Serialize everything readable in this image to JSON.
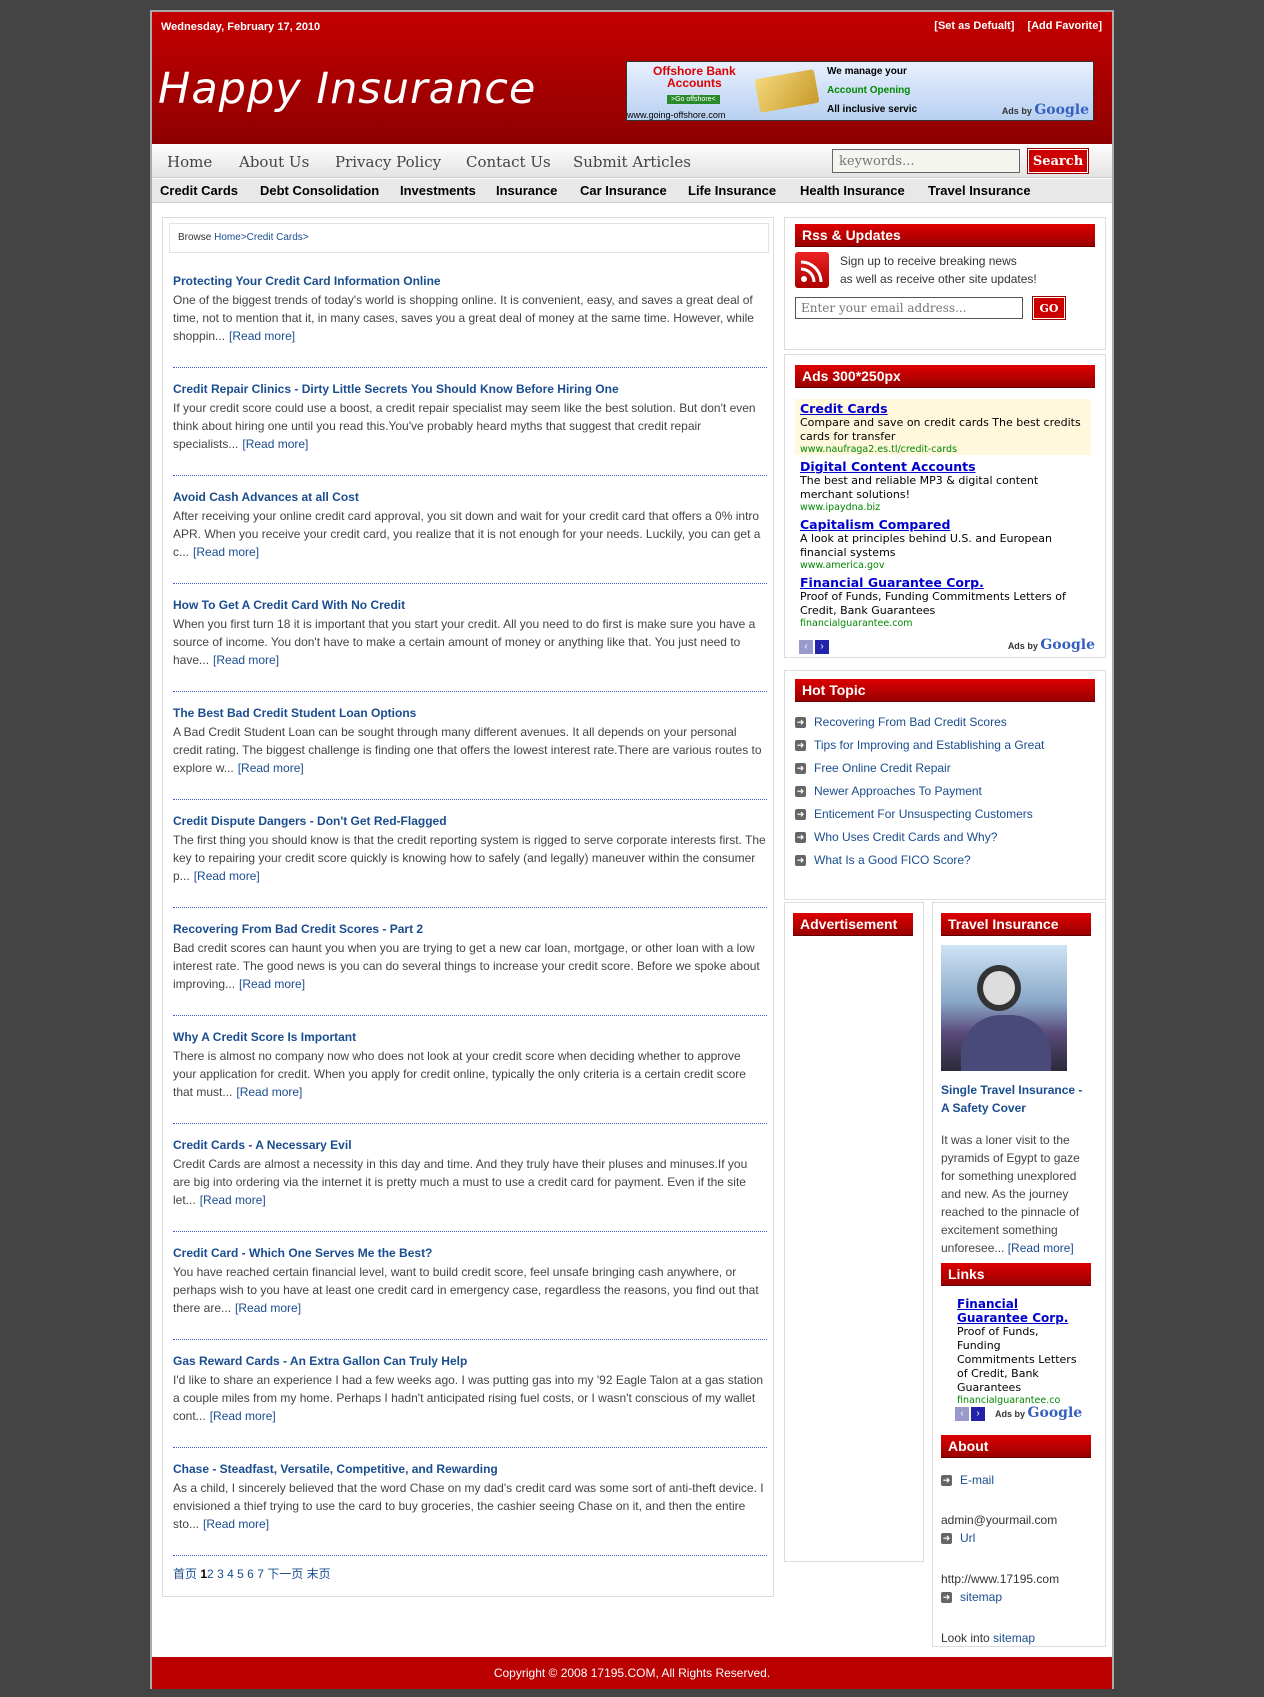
{
  "header": {
    "date": "Wednesday, February 17, 2010",
    "set_default": "[Set as Defualt]",
    "add_favorite": "[Add Favorite]",
    "site_title": "Happy Insurance",
    "banner": {
      "line1": "Offshore Bank",
      "line2": "Accounts",
      "cta": ">Go offshore<",
      "text1": "We manage your",
      "text2": "Account Opening",
      "text3": "All inclusive servic",
      "url": "www.going-offshore.com",
      "ads_by": "Ads by",
      "google": "Google"
    }
  },
  "nav": {
    "items": [
      "Home",
      "About Us",
      "Privacy Policy",
      "Contact Us",
      "Submit Articles"
    ],
    "search_placeholder": "keywords...",
    "search_button": "Search"
  },
  "categories": [
    "Credit Cards",
    "Debt Consolidation",
    "Investments",
    "Insurance",
    "Car Insurance",
    "Life Insurance",
    "Health Insurance",
    "Travel Insurance"
  ],
  "breadcrumb": {
    "prefix": "Browse",
    "home": "Home",
    "sep1": ">",
    "current": "Credit Cards",
    "sep2": ">"
  },
  "read_more": "[Read more]",
  "articles": [
    {
      "title": "Protecting Your Credit Card Information Online",
      "excerpt": "One of the biggest trends of today's world is shopping online. It is convenient, easy, and saves a great deal of time, not to mention that it, in many cases, saves you a great deal of money at the same time. However, while shoppin..."
    },
    {
      "title": "Credit Repair Clinics - Dirty Little Secrets You Should Know Before Hiring One",
      "excerpt": "If your credit score could use a boost, a credit repair specialist may seem like the best solution. But don't even think about hiring one until you read this.You've probably heard myths that suggest that credit repair specialists..."
    },
    {
      "title": "Avoid Cash Advances at all Cost",
      "excerpt": "After receiving your online credit card approval, you sit down and wait for your credit card that offers a 0% intro APR. When you receive your credit card, you realize that it is not enough for your needs. Luckily, you can get a c..."
    },
    {
      "title": "How To Get A Credit Card With No Credit",
      "excerpt": "When you first turn 18 it is important that you start your credit. All you need to do first is make sure you have a source of income. You don't have to make a certain amount of money or anything like that. You just need to have..."
    },
    {
      "title": "The Best Bad Credit Student Loan Options",
      "excerpt": "A Bad Credit Student Loan can be sought through many different avenues. It all depends on your personal credit rating. The biggest challenge is finding one that offers the lowest interest rate.There are various routes to explore w..."
    },
    {
      "title": "Credit Dispute Dangers - Don't Get Red-Flagged",
      "excerpt": "The first thing you should know is that the credit reporting system is rigged to serve corporate interests first. The key to repairing your credit score quickly is knowing how to safely (and legally) maneuver within the consumer p..."
    },
    {
      "title": "Recovering From Bad Credit Scores - Part 2",
      "excerpt": "Bad credit scores can haunt you when you are trying to get a new car loan, mortgage, or other loan with a low interest rate. The good news is you can do several things to increase your credit score. Before we spoke about improving..."
    },
    {
      "title": "Why A Credit Score Is Important",
      "excerpt": "There is almost no company now who does not look at your credit score when deciding whether to approve your application for credit. When you apply for credit online, typically the only criteria is a certain credit score that must..."
    },
    {
      "title": "Credit Cards - A Necessary Evil",
      "excerpt": "Credit Cards are almost a necessity in this day and time. And they truly have their pluses and minuses.If you are big into ordering via the internet it is pretty much a must to use a credit card for payment. Even if the site let..."
    },
    {
      "title": "Credit Card - Which One Serves Me the Best?",
      "excerpt": "You have reached certain financial level, want to build credit score, feel unsafe bringing cash anywhere, or perhaps wish to you have at least one credit card in emergency case, regardless the reasons, you find out that there are..."
    },
    {
      "title": "Gas Reward Cards - An Extra Gallon Can Truly Help",
      "excerpt": "I'd like to share an experience I had a few weeks ago. I was putting gas into my '92 Eagle Talon at a gas station a couple miles from my home. Perhaps I hadn't anticipated rising fuel costs, or I wasn't conscious of my wallet cont..."
    },
    {
      "title": "Chase - Steadfast, Versatile, Competitive, and Rewarding",
      "excerpt": "As a child, I sincerely believed that the word Chase on my dad's credit card was some sort of anti-theft device. I envisioned a thief trying to use the card to buy groceries, the cashier seeing Chase on it, and then the entire sto..."
    }
  ],
  "pager": {
    "first": "首页",
    "current": "1",
    "pages": [
      "2",
      "3",
      "4",
      "5",
      "6",
      "7"
    ],
    "next": "下一页",
    "last": "末页"
  },
  "rss": {
    "title": "Rss & Updates",
    "line1": "Sign up to receive breaking news",
    "line2": "as well as receive other site updates!",
    "email_placeholder": "Enter your email address...",
    "go": "GO"
  },
  "ads_panel": {
    "title": "Ads 300*250px",
    "ads": [
      {
        "headline": "Credit Cards",
        "desc": "Compare and save on credit cards The best credits cards for transfer",
        "url": "www.naufraga2.es.tl/credit-cards"
      },
      {
        "headline": "Digital Content Accounts",
        "desc": "The best and reliable MP3 & digital content merchant solutions!",
        "url": "www.ipaydna.biz"
      },
      {
        "headline": "Capitalism Compared",
        "desc": "A look at principles behind U.S. and European financial systems",
        "url": "www.america.gov"
      },
      {
        "headline": "Financial Guarantee Corp.",
        "desc": "Proof of Funds, Funding Commitments Letters of Credit, Bank Guarantees",
        "url": "financialguarantee.com"
      }
    ],
    "ads_by": "Ads by",
    "google": "Google"
  },
  "hot_topic": {
    "title": "Hot Topic",
    "items": [
      "Recovering From Bad Credit Scores",
      "Tips for Improving and Establishing a Great",
      "Free Online Credit Repair",
      "Newer Approaches To Payment",
      "Enticement For Unsuspecting Customers",
      "Who Uses Credit Cards and Why?",
      "What Is a Good FICO Score?"
    ]
  },
  "advertisement": {
    "title": "Advertisement"
  },
  "travel": {
    "title": "Travel Insurance",
    "article_title": "Single Travel Insurance - A Safety Cover",
    "excerpt": "It was a loner visit to the pyramids of Egypt to gaze for something unexplored and new. As the journey reached to the pinnacle of excitement something unforesee...",
    "read_more": "[Read more]"
  },
  "links": {
    "title": "Links",
    "ad_headline": "Financial Guarantee Corp.",
    "ad_desc": "Proof of Funds, Funding Commitments Letters of Credit, Bank Guarantees",
    "ad_url": "financialguarantee.co",
    "ads_by": "Ads by",
    "google": "Google"
  },
  "about": {
    "title": "About",
    "email_label": "E-mail",
    "email": "admin@yourmail.com",
    "url_label": "Url",
    "url": "http://www.17195.com",
    "sitemap_label": "sitemap",
    "look_into": "Look into",
    "sitemap": "sitemap"
  },
  "footer": {
    "copyright": "Copyright © 2008 17195.COM, All Rights Reserved."
  },
  "colors": {
    "brand_red": "#c00000",
    "link_blue": "#1a4d8f",
    "page_bg": "#444444"
  }
}
